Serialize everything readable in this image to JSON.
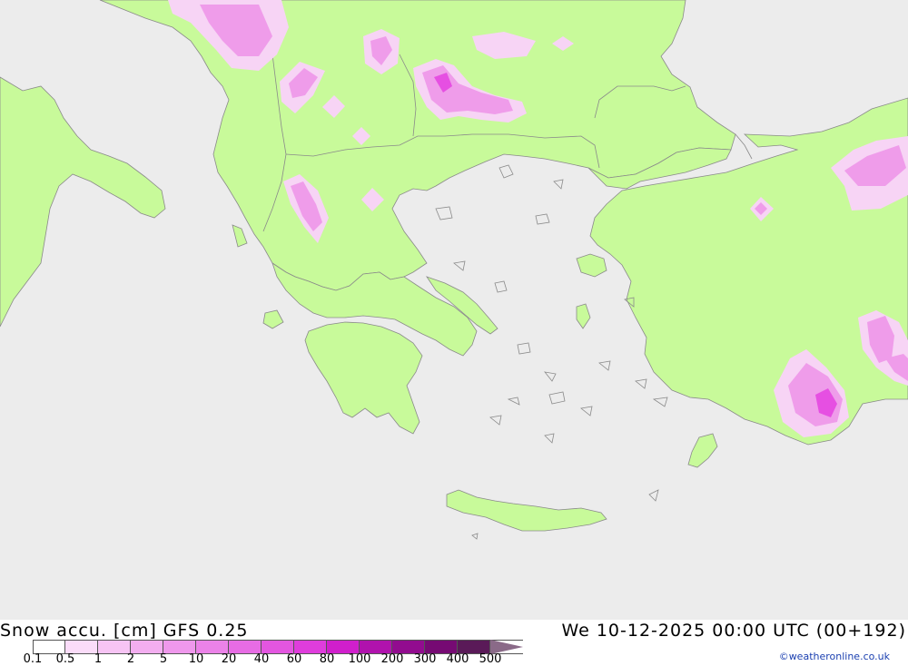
{
  "map": {
    "region": "Greece / Aegean Sea",
    "colors": {
      "sea": "#ececec",
      "land": "#c8fa9a",
      "coast": "#8a8a8a",
      "snow_light": "#f7d4f5",
      "snow_mid": "#ef9cea",
      "snow_strong": "#e64fe2"
    }
  },
  "footer": {
    "title": "Snow accu. [cm] GFS 0.25",
    "datetime": "We 10-12-2025 00:00 UTC (00+192)",
    "credit": "©weatheronline.co.uk"
  },
  "legend": {
    "labels": [
      "0.1",
      "0.5",
      "1",
      "2",
      "5",
      "10",
      "20",
      "40",
      "60",
      "80",
      "100",
      "200",
      "300",
      "400",
      "500"
    ],
    "colors": [
      "#ffffff",
      "#fbdcf9",
      "#f7c4f4",
      "#f3aef0",
      "#ef98ec",
      "#eb82e8",
      "#e76ce4",
      "#e356e0",
      "#df3ddc",
      "#d01fcc",
      "#b012ad",
      "#920c8f",
      "#760a73",
      "#5a1a58",
      "#6b3a69"
    ],
    "arrow_color": "#8a6a88"
  }
}
